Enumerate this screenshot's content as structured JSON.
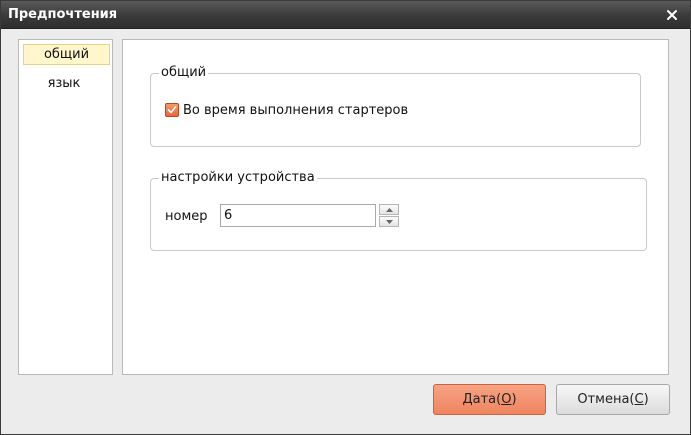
{
  "window": {
    "title": "Предпочтения"
  },
  "sidebar": {
    "items": [
      {
        "label": "общий",
        "active": true
      },
      {
        "label": "язык",
        "active": false
      }
    ]
  },
  "general_group": {
    "title": "общий",
    "checkbox_label": "Во время выполнения стартеров",
    "checkbox_checked": true
  },
  "device_group": {
    "title": "настройки устройства",
    "number_label": "номер",
    "number_value": "6"
  },
  "buttons": {
    "ok_text": "Дата(",
    "ok_accel": "O",
    "ok_close": ")",
    "cancel_text": "Отмена(",
    "cancel_accel": "C",
    "cancel_close": ")"
  },
  "colors": {
    "title_bar": "#3a3a3a",
    "accent_orange": "#ef8460",
    "active_item": "#fff6cc"
  },
  "icons": {
    "close": "close-icon",
    "check": "check-icon",
    "spin_up": "arrow-up-icon",
    "spin_down": "arrow-down-icon"
  }
}
